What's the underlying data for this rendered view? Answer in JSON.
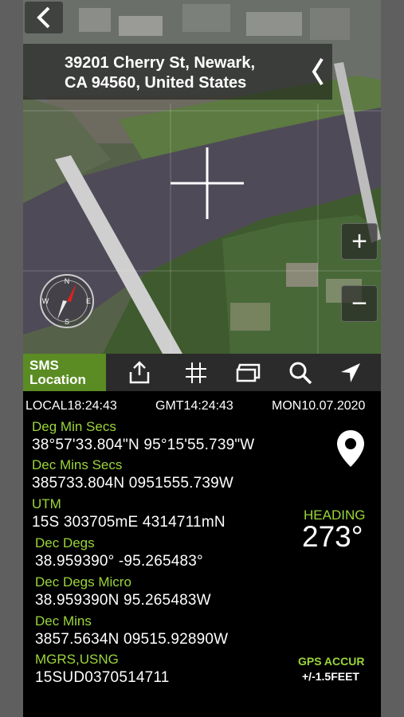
{
  "map": {
    "address": "39201 Cherry St, Newark,\nCA  94560, United States",
    "zoom_in_label": "+",
    "zoom_out_label": "−"
  },
  "toolbar": {
    "sms_line1": "SMS",
    "sms_line2": "Location",
    "icons": [
      "share-icon",
      "grid-icon",
      "layers-icon",
      "search-icon",
      "location-arrow-icon"
    ]
  },
  "time": {
    "local": "LOCAL18:24:43",
    "gmt": "GMT14:24:43",
    "date": "MON10.07.2020"
  },
  "coords": {
    "dms_label": "Deg Min Secs",
    "dms_value": "38°57'33.804\"N 95°15'55.739\"W",
    "dec_mins_secs_label": "Dec Mins Secs",
    "dec_mins_secs_value": "385733.804N   0951555.739W",
    "utm_label": "UTM",
    "utm_value": "15S 303705mE     4314711mN",
    "dec_degs_label": "Dec Degs",
    "dec_degs_value": "38.959390°    -95.265483°",
    "dec_degs_micro_label": "Dec Degs Micro",
    "dec_degs_micro_value": "38.959390N    95.265483W",
    "dec_mins_label": "Dec Mins",
    "dec_mins_value": "3857.5634N 09515.92890W",
    "mgrs_label": "MGRS,USNG",
    "mgrs_value": "15SUD0370514711"
  },
  "heading": {
    "label": "HEADING",
    "value": "273°"
  },
  "gps": {
    "label": "GPS ACCUR",
    "value": "+/-1.5FEET"
  },
  "colors": {
    "accent_green": "#9bd53a",
    "sms_green": "#5a8c23",
    "toolbar_bg": "#2b2b2b"
  }
}
